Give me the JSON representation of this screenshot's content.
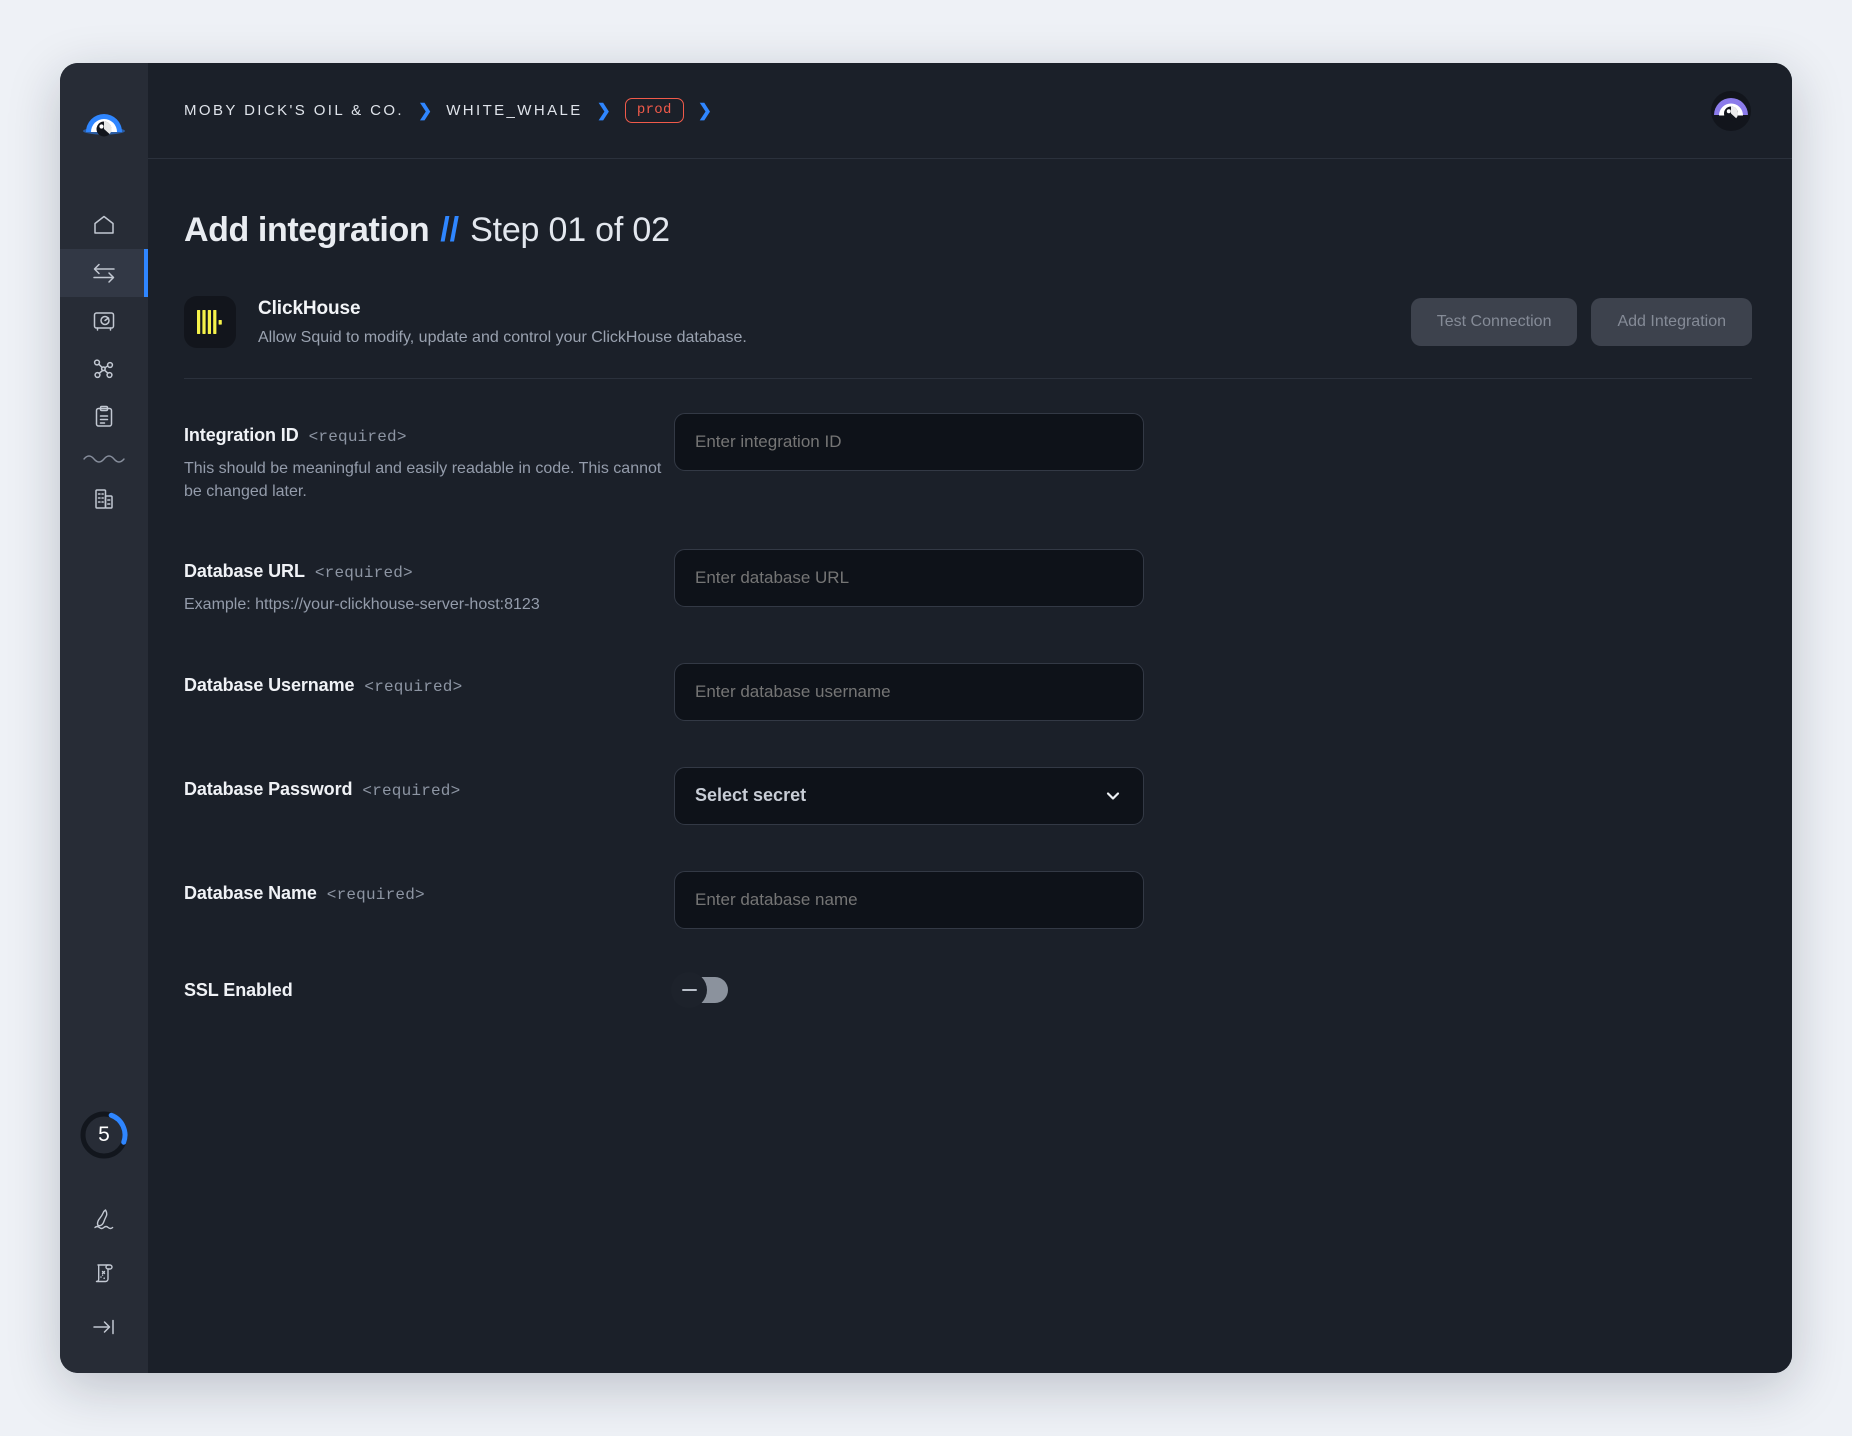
{
  "breadcrumb": {
    "org": "MOBY DICK'S OIL & CO.",
    "project": "WHITE_WHALE",
    "environment": "prod",
    "separator": "❯"
  },
  "page": {
    "title_strong": "Add integration",
    "title_slashes": "//",
    "title_step": "Step 01 of 02"
  },
  "integration": {
    "name": "ClickHouse",
    "description": "Allow Squid to modify, update and control your ClickHouse database.",
    "test_connection_label": "Test Connection",
    "add_integration_label": "Add Integration"
  },
  "fields": {
    "integration_id": {
      "label": "Integration ID",
      "required_tag": "<required>",
      "hint": "This should be meaningful and easily readable in code. This cannot be changed later.",
      "placeholder": "Enter integration ID",
      "value": ""
    },
    "database_url": {
      "label": "Database URL",
      "required_tag": "<required>",
      "hint": "Example: https://your-clickhouse-server-host:8123",
      "placeholder": "Enter database URL",
      "value": ""
    },
    "database_username": {
      "label": "Database Username",
      "required_tag": "<required>",
      "placeholder": "Enter database username",
      "value": ""
    },
    "database_password": {
      "label": "Database Password",
      "required_tag": "<required>",
      "selected_option": "Select secret"
    },
    "database_name": {
      "label": "Database Name",
      "required_tag": "<required>",
      "placeholder": "Enter database name",
      "value": ""
    },
    "ssl_enabled": {
      "label": "SSL Enabled",
      "state": "off"
    }
  },
  "sidebar": {
    "items": [
      {
        "name": "home",
        "icon": "home-icon"
      },
      {
        "name": "integrations",
        "icon": "integrations-arrows-icon",
        "active": true
      },
      {
        "name": "secrets",
        "icon": "safe-vault-icon"
      },
      {
        "name": "schema",
        "icon": "graph-nodes-icon"
      },
      {
        "name": "logs",
        "icon": "clipboard-icon"
      },
      {
        "name": "organization",
        "icon": "building-icon"
      }
    ],
    "progress_count": "5",
    "bottom_items": [
      {
        "name": "message-in-bottle",
        "icon": "bottle-icon"
      },
      {
        "name": "treasure-map",
        "icon": "scroll-map-icon"
      },
      {
        "name": "collapse-sidebar",
        "icon": "collapse-arrow-icon"
      }
    ]
  },
  "colors": {
    "accent_blue": "#2f86ff",
    "chip_red": "#f05a4a",
    "clickhouse_yellow": "#f5f24a",
    "avatar_purple": "#8b7bea"
  }
}
